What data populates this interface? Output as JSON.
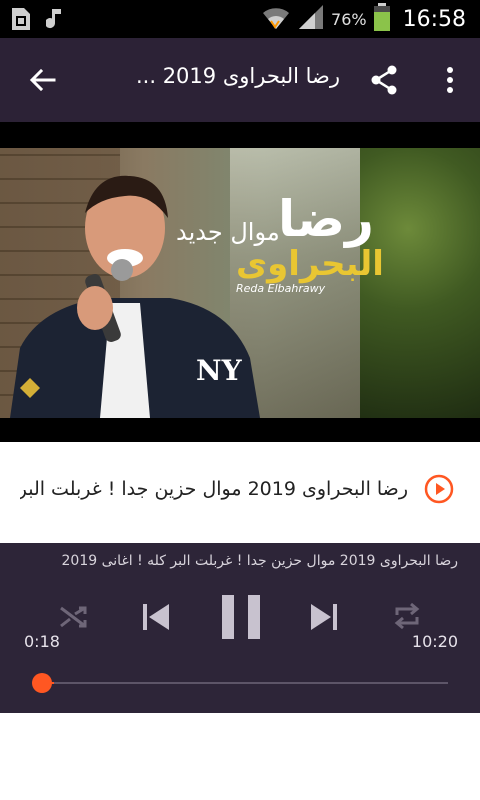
{
  "status_bar": {
    "battery_percent": "76%",
    "clock": "16:58",
    "battery_level": 0.76,
    "icons": [
      "sim-icon",
      "music-note-icon",
      "wifi-icon",
      "signal-icon",
      "battery-icon"
    ]
  },
  "toolbar": {
    "title": "رضا البحراوى 2019 ..."
  },
  "thumbnail": {
    "name_line1": "رضا",
    "name_line2": "البحراوى",
    "tagline": "موال جديد",
    "signature": "Reda Elbahrawy"
  },
  "now_playing": {
    "title": "رضا البحراوى 2019 موال حزين جدا ! غربلت البر..."
  },
  "player": {
    "track_title": "رضا البحراوى 2019 موال حزين جدا ! غربلت البر كله ! اغانى 2019",
    "elapsed": "0:18",
    "duration": "10:20",
    "progress": 0.029
  },
  "colors": {
    "toolbar_bg": "#2c2236",
    "player_bg": "#2d2538",
    "accent": "#ff5722"
  }
}
